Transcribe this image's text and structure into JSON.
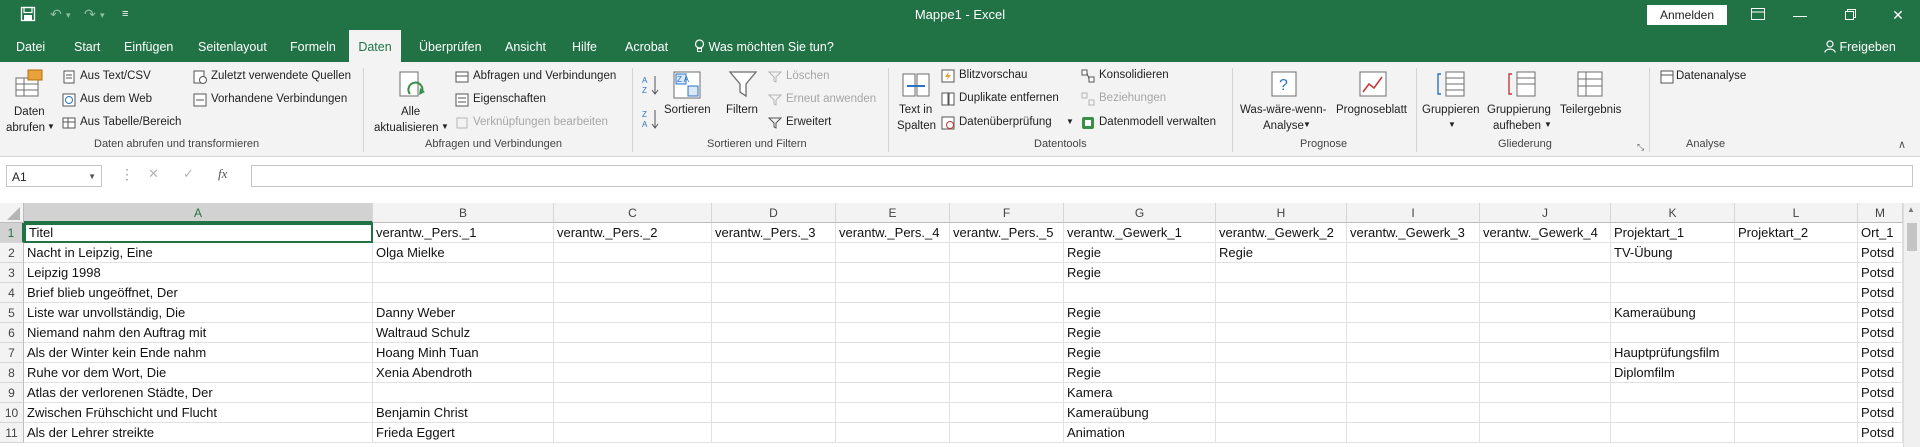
{
  "window": {
    "title": "Mappe1  -  Excel",
    "signin_label": "Anmelden"
  },
  "tabs": [
    "Datei",
    "Start",
    "Einfügen",
    "Seitenlayout",
    "Formeln",
    "Daten",
    "Überprüfen",
    "Ansicht",
    "Hilfe",
    "Acrobat"
  ],
  "active_tab": "Daten",
  "tell_me": "Was möchten Sie tun?",
  "share_label": "Freigeben",
  "ribbon": {
    "get_data": {
      "daten_abrufen_line1": "Daten",
      "daten_abrufen_line2": "abrufen",
      "aus_text_csv": "Aus Text/CSV",
      "aus_dem_web": "Aus dem Web",
      "aus_tabelle": "Aus Tabelle/Bereich",
      "zuletzt": "Zuletzt verwendete Quellen",
      "vorhandene": "Vorhandene Verbindungen",
      "group_label": "Daten abrufen und transformieren"
    },
    "queries": {
      "alle_line1": "Alle",
      "alle_line2": "aktualisieren",
      "abfragen": "Abfragen und Verbindungen",
      "eigenschaften": "Eigenschaften",
      "verknuepfungen": "Verknüpfungen bearbeiten",
      "group_label": "Abfragen und Verbindungen"
    },
    "sort": {
      "sortieren": "Sortieren",
      "filtern": "Filtern",
      "loeschen": "Löschen",
      "erneut": "Erneut anwenden",
      "erweitert": "Erweitert",
      "group_label": "Sortieren und Filtern"
    },
    "tools": {
      "text_line1": "Text in",
      "text_line2": "Spalten",
      "blitz": "Blitzvorschau",
      "duplikate": "Duplikate entfernen",
      "datenueberpruefung": "Datenüberprüfung",
      "konsolidieren": "Konsolidieren",
      "beziehungen": "Beziehungen",
      "datenmodell": "Datenmodell verwalten",
      "group_label": "Datentools"
    },
    "forecast": {
      "was_line1": "Was-wäre-wenn-",
      "was_line2": "Analyse",
      "prognoseblatt": "Prognoseblatt",
      "group_label": "Prognose"
    },
    "outline": {
      "gruppieren": "Gruppieren",
      "grp_aufheben_line1": "Gruppierung",
      "grp_aufheben_line2": "aufheben",
      "teilergebnis": "Teilergebnis",
      "group_label": "Gliederung"
    },
    "analysis": {
      "datenanalyse": "Datenanalyse",
      "group_label": "Analyse"
    }
  },
  "formula_bar": {
    "name_box": "A1",
    "formula": ""
  },
  "sheet": {
    "columns": [
      "A",
      "B",
      "C",
      "D",
      "E",
      "F",
      "G",
      "H",
      "I",
      "J",
      "K",
      "L",
      "M"
    ],
    "row_numbers": [
      "1",
      "2",
      "3",
      "4",
      "5",
      "6",
      "7",
      "8",
      "9",
      "10",
      "11"
    ],
    "rows": [
      [
        "Titel",
        "verantw._Pers._1",
        "verantw._Pers._2",
        "verantw._Pers._3",
        "verantw._Pers._4",
        "verantw._Pers._5",
        "verantw._Gewerk_1",
        "verantw._Gewerk_2",
        "verantw._Gewerk_3",
        "verantw._Gewerk_4",
        "Projektart_1",
        "Projektart_2",
        "Ort_1"
      ],
      [
        "Nacht in Leipzig, Eine",
        "Olga Mielke",
        "",
        "",
        "",
        "",
        "Regie",
        "Regie",
        "",
        "",
        "TV-Übung",
        "",
        "Potsd"
      ],
      [
        "Leipzig 1998",
        "",
        "",
        "",
        "",
        "",
        "Regie",
        "",
        "",
        "",
        "",
        "",
        "Potsd"
      ],
      [
        "Brief blieb ungeöffnet, Der",
        "",
        "",
        "",
        "",
        "",
        "",
        "",
        "",
        "",
        "",
        "",
        "Potsd"
      ],
      [
        "Liste war unvollständig, Die",
        "Danny Weber",
        "",
        "",
        "",
        "",
        "Regie",
        "",
        "",
        "",
        "Kameraübung",
        "",
        "Potsd"
      ],
      [
        "Niemand nahm den Auftrag mit",
        "Waltraud Schulz",
        "",
        "",
        "",
        "",
        "Regie",
        "",
        "",
        "",
        "",
        "",
        "Potsd"
      ],
      [
        "Als der Winter kein Ende nahm",
        "Hoang Minh Tuan",
        "",
        "",
        "",
        "",
        "Regie",
        "",
        "",
        "",
        "Hauptprüfungsfilm",
        "",
        "Potsd"
      ],
      [
        "Ruhe vor dem Wort, Die",
        "Xenia Abendroth",
        "",
        "",
        "",
        "",
        "Regie",
        "",
        "",
        "",
        "Diplomfilm",
        "",
        "Potsd"
      ],
      [
        "Atlas der verlorenen Städte, Der",
        "",
        "",
        "",
        "",
        "",
        "Kamera",
        "",
        "",
        "",
        "",
        "",
        "Potsd"
      ],
      [
        "Zwischen Frühschicht und Flucht",
        "Benjamin Christ",
        "",
        "",
        "",
        "",
        "Kameraübung",
        "",
        "",
        "",
        "",
        "",
        "Potsd"
      ],
      [
        "Als der Lehrer streikte",
        "Frieda Eggert",
        "",
        "",
        "",
        "",
        "Animation",
        "",
        "",
        "",
        "",
        "",
        "Potsd"
      ]
    ]
  },
  "colors": {
    "excel_green": "#217346",
    "ribbon_bg": "#f3f3f3"
  }
}
